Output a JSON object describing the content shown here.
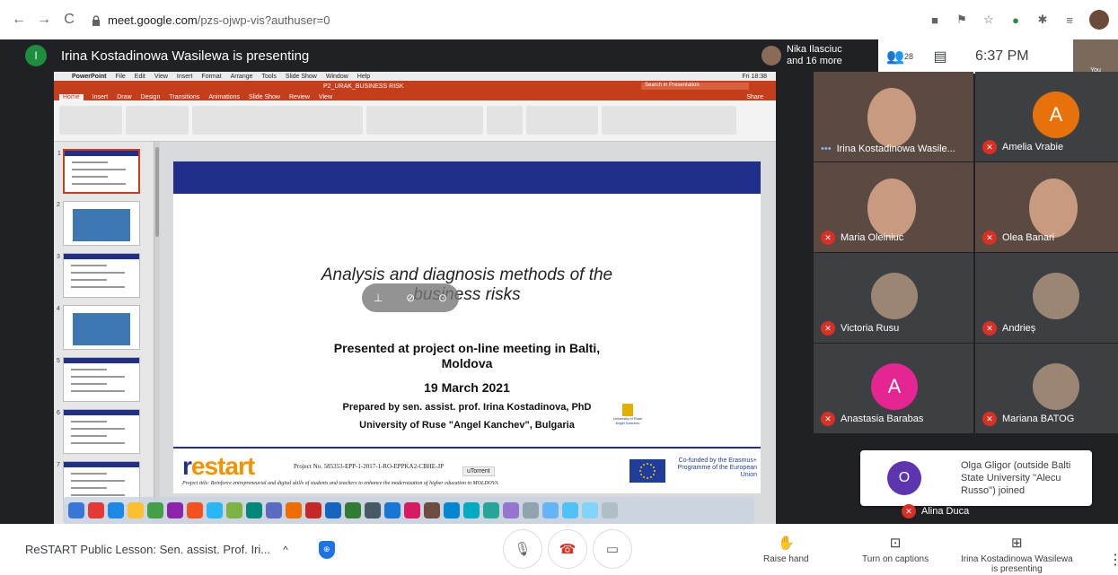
{
  "browser": {
    "url_host": "meet.google.com",
    "url_path": "/pzs-ojwp-vis?authuser=0"
  },
  "meet_top": {
    "presenter_initial": "I",
    "presenting_title": "Irina Kostadinowa Wasilewa is presenting",
    "participants_peek_line1": "Nika Ilasciuc",
    "participants_peek_line2": "and 16 more",
    "people_count": "28",
    "clock": "6:37 PM",
    "you_label": "You"
  },
  "ppt": {
    "menu_items": [
      "PowerPoint",
      "File",
      "Edit",
      "View",
      "Insert",
      "Format",
      "Arrange",
      "Tools",
      "Slide Show",
      "Window",
      "Help"
    ],
    "menu_right": "Fri 18:38",
    "doc_title": "P2_URAK_BUSINESS RISK",
    "search_placeholder": "Search in Presentation",
    "tabs": [
      "Home",
      "Insert",
      "Draw",
      "Design",
      "Transitions",
      "Animations",
      "Slide Show",
      "Review",
      "View"
    ],
    "share_label": "Share",
    "thumb_numbers": [
      "1",
      "2",
      "3",
      "4",
      "5",
      "6",
      "7"
    ]
  },
  "slide": {
    "title_line1": "Analysis and diagnosis methods of the",
    "title_line2": "business risks",
    "presented_line1": "Presented at project on-line meeting in Balti,",
    "presented_line2": "Moldova",
    "date": "19 March 2021",
    "prepared_by": "Prepared by sen. assist. prof. Irina Kostadinova, PhD",
    "university": "University of Ruse \"Angel Kanchev\", Bulgaria",
    "uni_logo_text": "University of Ruse Angel Kanchev",
    "restart_r": "r",
    "restart_rest": "estart",
    "project_no": "Project No. 585353-EPP-1-2017-1-RO-EPPKA2-CBHE-JP",
    "project_title": "Project title: Reinforce entrepreneurial and digital skills of students and teachers to enhance the modernization of higher education in MOLDOVA",
    "eu_text": "Co-funded by the Erasmus+ Programme of the European Union",
    "utorrent_tip": "uTorrent"
  },
  "participants": [
    {
      "name": "Irina Kostadinowa Wasile...",
      "muted": false,
      "type": "video"
    },
    {
      "name": "Amelia Vrabie",
      "muted": true,
      "type": "letter",
      "letter": "A",
      "color": "#e8710a"
    },
    {
      "name": "Maria Oleiniuc",
      "muted": true,
      "type": "video"
    },
    {
      "name": "Olea Banari",
      "muted": true,
      "type": "video"
    },
    {
      "name": "Victoria Rusu",
      "muted": true,
      "type": "photo"
    },
    {
      "name": "Andrieș",
      "muted": true,
      "type": "photo"
    },
    {
      "name": "Anastasia Barabas",
      "muted": true,
      "type": "letter",
      "letter": "A",
      "color": "#e52592"
    },
    {
      "name": "Mariana BATOG",
      "muted": true,
      "type": "photo"
    }
  ],
  "toast": {
    "initial": "O",
    "message": "Olga Gligor (outside Balti State University \"Alecu Russo\") joined"
  },
  "alina": "Alina Duca",
  "bottom": {
    "meeting_name": "ReSTART Public Lesson: Sen. assist. Prof. Iri...",
    "raise_hand": "Raise hand",
    "captions": "Turn on captions",
    "presenting_line1": "Irina Kostadinowa Wasilewa",
    "presenting_line2": "is presenting"
  },
  "colors": {
    "ppt_accent": "#c43e1c",
    "slide_bar": "#1f2f8a",
    "mute_red": "#d93025",
    "toast_avatar": "#5e35b1"
  }
}
